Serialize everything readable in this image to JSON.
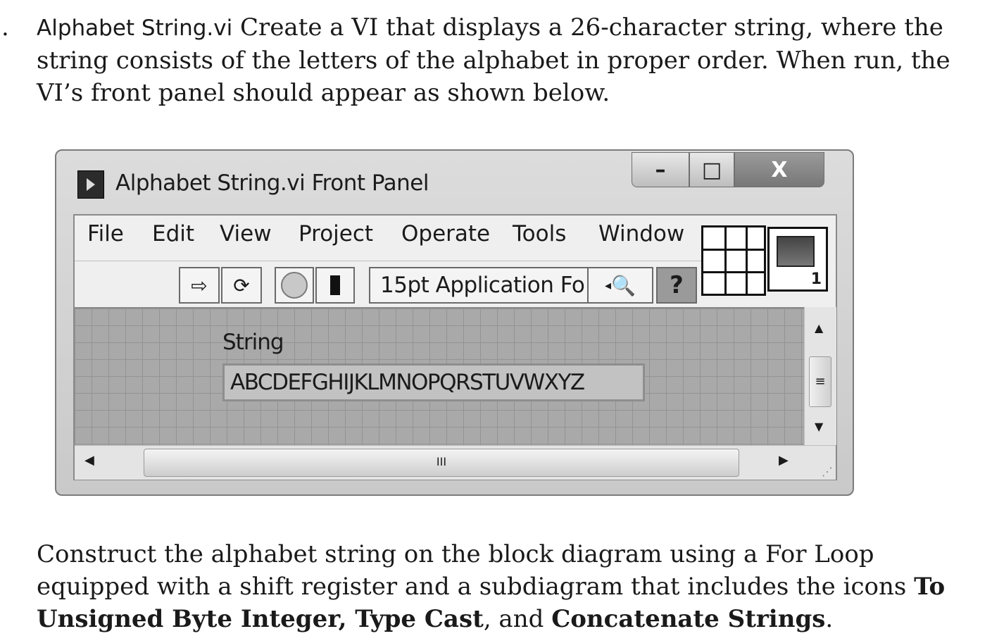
{
  "exercise_number": ".",
  "intro": {
    "vi_name": "Alphabet String.vi",
    "line1_rest": "Create a VI that displays a 26-character string, where the",
    "line2": "string consists of the letters of the alphabet in proper order. When run, the",
    "line3": "VI’s front panel should appear as shown below."
  },
  "window": {
    "title": "Alphabet String.vi Front Panel",
    "controls": {
      "minimize": "–",
      "maximize": "□",
      "close": "X"
    },
    "menu": [
      "File",
      "Edit",
      "View",
      "Project",
      "Operate",
      "Tools",
      "Window"
    ],
    "toolbar": {
      "run_glyph": "⇨",
      "run_continuously_glyph": "⟳",
      "font": "15pt Application Fo",
      "font_arrow": "◂",
      "search_glyph": "🔍",
      "help": "?"
    },
    "icon_number": "1",
    "panel": {
      "label": "String",
      "value": "ABCDEFGHIJKLMNOPQRSTUVWXYZ"
    },
    "scrollbar": {
      "up": "▲",
      "down": "▼",
      "left": "◀",
      "right": "▶",
      "v_thumb": "≡",
      "h_thumb": "III",
      "grip": "⋰"
    }
  },
  "outro": {
    "line1": "Construct the alphabet string on the block diagram using a For Loop",
    "line2_text": "equipped with a shift register and a subdiagram that includes the icons",
    "line2_bold": "To",
    "line3_bold1": "Unsigned Byte Integer, Type Cast",
    "line3_mid": ", and",
    "line3_bold2": "Concatenate Strings",
    "line3_end": "."
  }
}
